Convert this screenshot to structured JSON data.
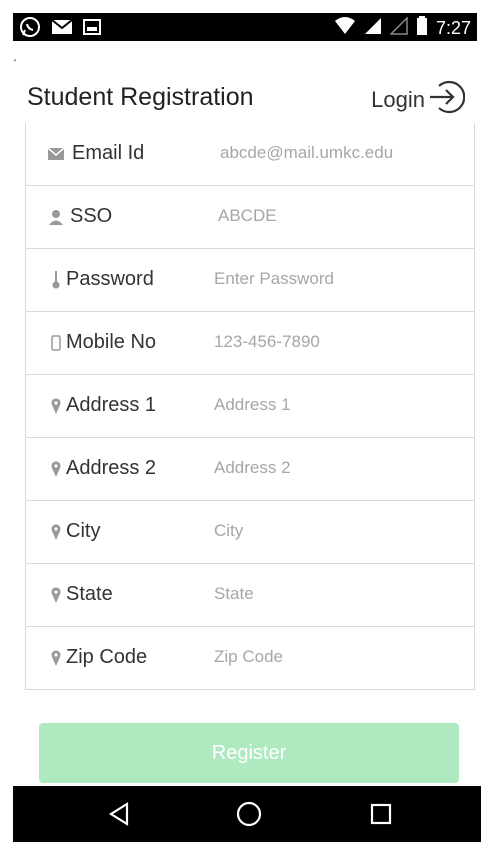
{
  "status_bar": {
    "time": "7:27",
    "icons_left": [
      "whatsapp-icon",
      "mail-icon",
      "image-icon"
    ],
    "icons_right": [
      "wifi-icon",
      "signal-icon",
      "signal-empty-icon",
      "battery-icon"
    ]
  },
  "dot": ".",
  "header": {
    "title": "Student Registration",
    "login_label": "Login"
  },
  "form": {
    "rows": [
      {
        "label": "Email Id",
        "value": "abcde@mail.umkc.edu",
        "icon": "envelope-icon"
      },
      {
        "label": "SSO",
        "value": "ABCDE",
        "icon": "person-icon"
      },
      {
        "label": "Password",
        "value": "Enter Password",
        "icon": "thermometer-icon"
      },
      {
        "label": "Mobile No",
        "value": "123-456-7890",
        "icon": "phone-icon"
      },
      {
        "label": "Address 1",
        "value": "Address 1",
        "icon": "location-pin-icon"
      },
      {
        "label": "Address 2",
        "value": "Address 2",
        "icon": "location-pin-icon"
      },
      {
        "label": "City",
        "value": "City",
        "icon": "location-pin-icon"
      },
      {
        "label": "State",
        "value": "State",
        "icon": "location-pin-icon"
      },
      {
        "label": "Zip Code",
        "value": "Zip Code",
        "icon": "location-pin-icon"
      }
    ]
  },
  "register_label": "Register",
  "colors": {
    "register_bg": "#aee9c0",
    "border": "#d9d9d9",
    "placeholder": "#a6a6a6"
  }
}
